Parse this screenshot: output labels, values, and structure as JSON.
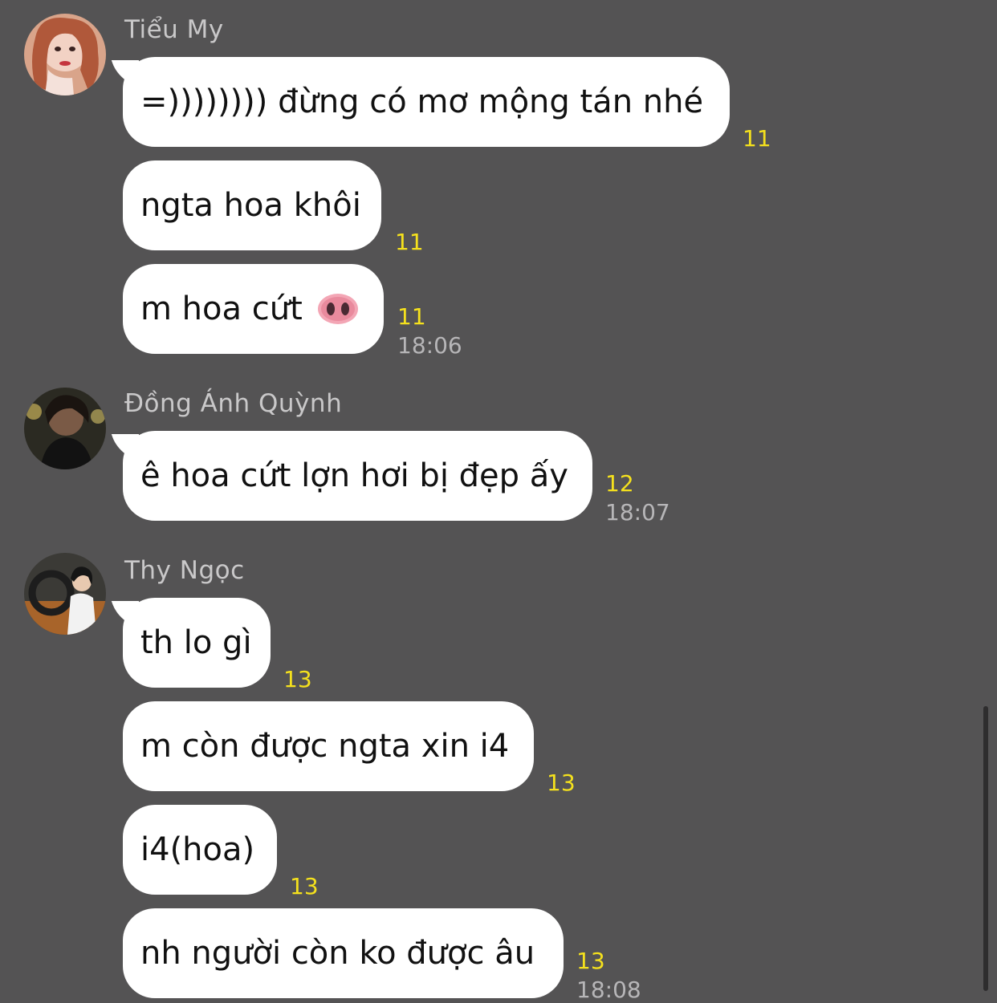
{
  "colors": {
    "background": "#545354",
    "bubble": "#ffffff",
    "read_count": "#f5e11d",
    "timestamp": "#b7b6b8",
    "sender_name": "#c9c8c9"
  },
  "groups": [
    {
      "sender": "Tiểu My",
      "avatar": "avatar-photo-icon",
      "messages": [
        {
          "text": "=)))))))) đừng có mơ mộng tán nhé",
          "count": "11",
          "time": ""
        },
        {
          "text": "ngta hoa khôi",
          "count": "11",
          "time": ""
        },
        {
          "text": "m hoa cứt",
          "emoji": "pig-nose-icon",
          "count": "11",
          "time": "18:06"
        }
      ]
    },
    {
      "sender": "Đồng Ánh Quỳnh",
      "avatar": "avatar-photo-icon",
      "messages": [
        {
          "text": "ê hoa cứt lợn hơi bị đẹp ấy",
          "count": "12",
          "time": "18:07"
        }
      ]
    },
    {
      "sender": "Thy Ngọc",
      "avatar": "avatar-photo-icon",
      "messages": [
        {
          "text": "th lo gì",
          "count": "13",
          "time": ""
        },
        {
          "text": "m còn được ngta xin i4",
          "count": "13",
          "time": ""
        },
        {
          "text": "i4(hoa)",
          "count": "13",
          "time": ""
        },
        {
          "text": "nh người còn ko được âu",
          "count": "13",
          "time": "18:08"
        }
      ]
    }
  ]
}
